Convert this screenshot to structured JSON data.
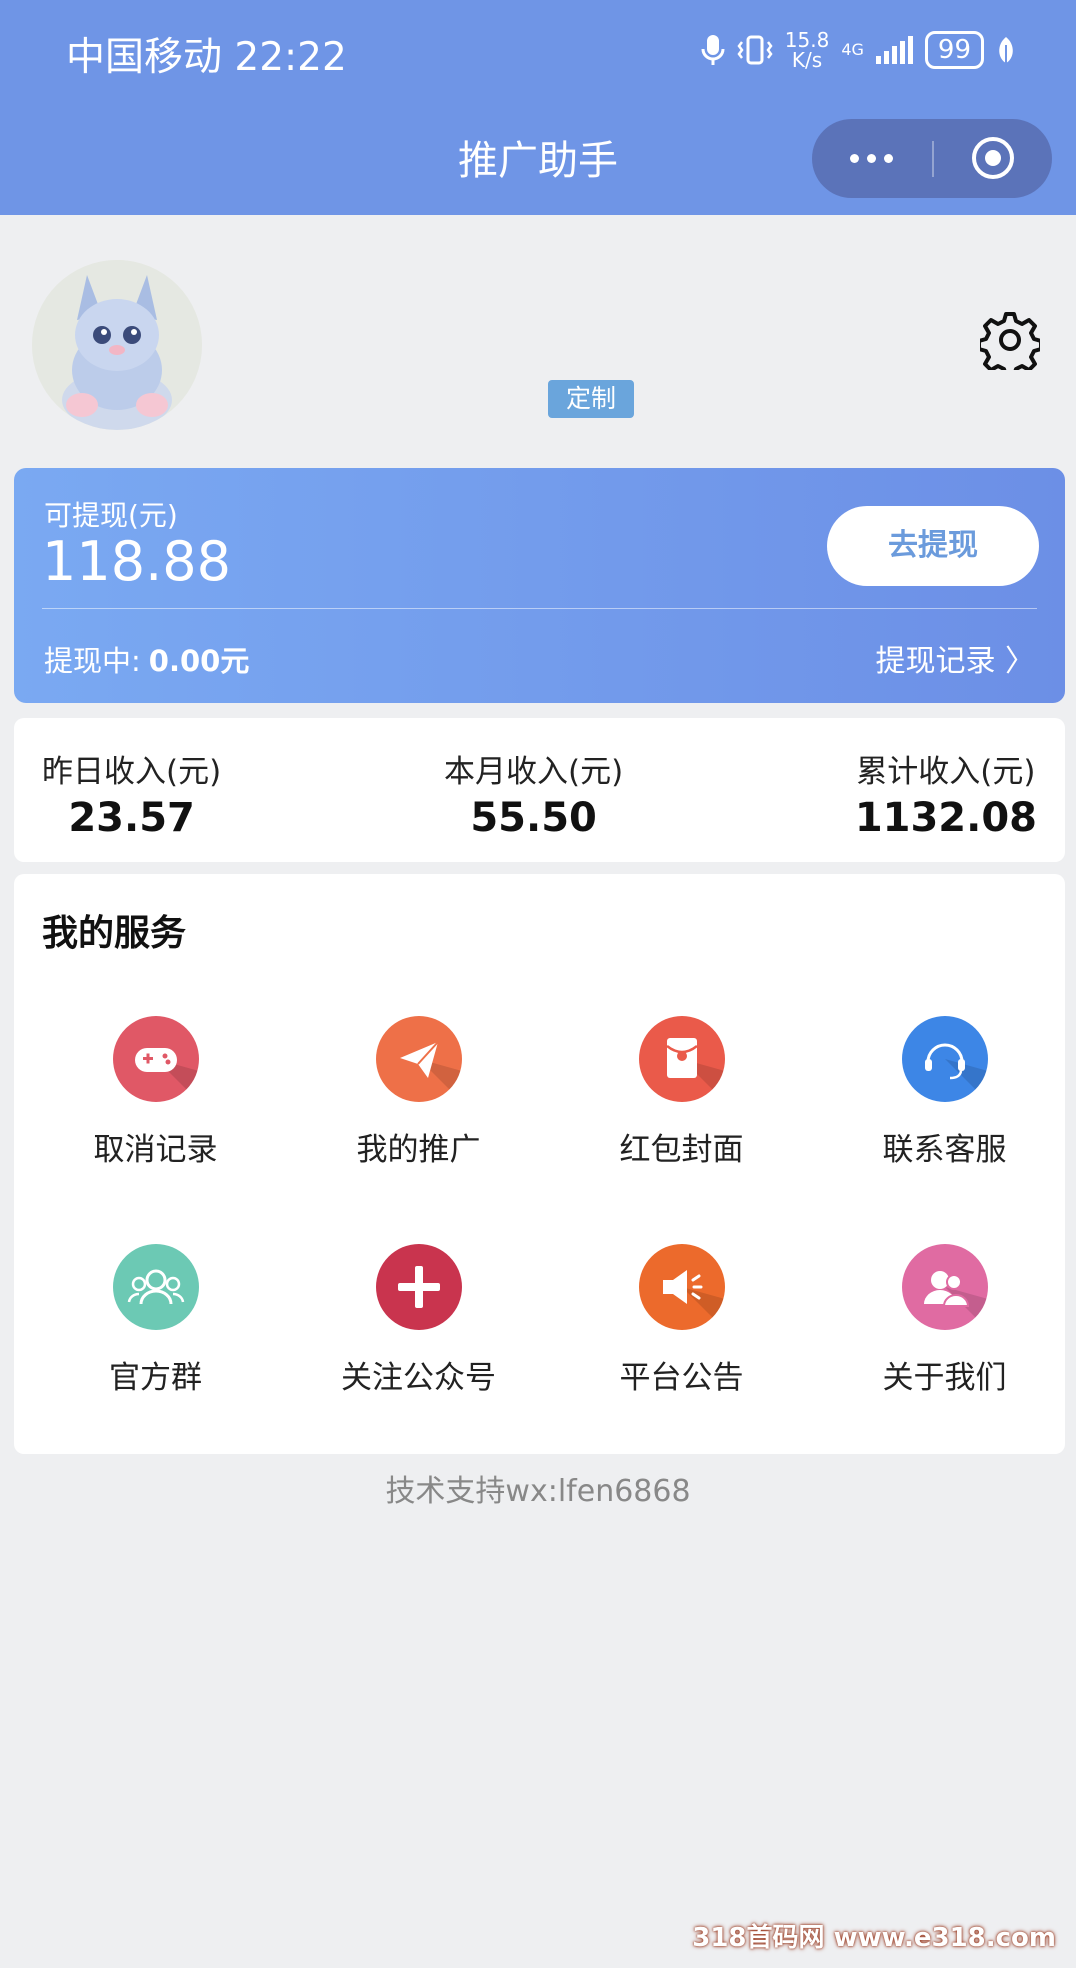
{
  "status_bar": {
    "carrier_time": "中国移动 22:22",
    "speed": "15.8",
    "speed_unit": "K/s",
    "net": "4G",
    "battery": "99"
  },
  "nav": {
    "title": "推广助手"
  },
  "profile": {
    "tag": "定制"
  },
  "balance": {
    "label": "可提现(元)",
    "value": "118.88",
    "withdraw_button": "去提现",
    "pending_label": "提现中:",
    "pending_value": "0.00元",
    "records_link": "提现记录 〉"
  },
  "income": [
    {
      "label": "昨日收入(元)",
      "value": "23.57"
    },
    {
      "label": "本月收入(元)",
      "value": "55.50"
    },
    {
      "label": "累计收入(元)",
      "value": "1132.08"
    }
  ],
  "services": {
    "title": "我的服务",
    "items": [
      {
        "label": "取消记录",
        "icon": "gamepad-icon",
        "color": "#e05866"
      },
      {
        "label": "我的推广",
        "icon": "paper-plane-icon",
        "color": "#ee7048"
      },
      {
        "label": "红包封面",
        "icon": "red-envelope-icon",
        "color": "#ea5a4a"
      },
      {
        "label": "联系客服",
        "icon": "headset-icon",
        "color": "#3d86e6"
      },
      {
        "label": "官方群",
        "icon": "group-icon",
        "color": "#6cc9b4"
      },
      {
        "label": "关注公众号",
        "icon": "plus-icon",
        "color": "#c9344e"
      },
      {
        "label": "平台公告",
        "icon": "megaphone-icon",
        "color": "#ec6a2c"
      },
      {
        "label": "关于我们",
        "icon": "users-icon",
        "color": "#e06ba2"
      }
    ]
  },
  "footer": {
    "support": "技术支持wx:lfen6868"
  },
  "watermark": "318首码网 www.e318.com"
}
